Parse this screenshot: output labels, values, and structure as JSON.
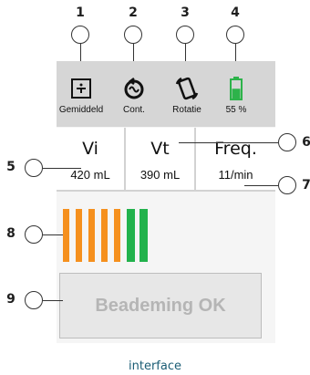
{
  "callouts": {
    "c1": "1",
    "c2": "2",
    "c3": "3",
    "c4": "4",
    "c5": "5",
    "c6": "6",
    "c7": "7",
    "c8": "8",
    "c9": "9"
  },
  "topbar": {
    "mode": {
      "icon": "average-icon",
      "label": "Gemiddeld"
    },
    "cont": {
      "icon": "continuous-cycle-icon",
      "label": "Cont."
    },
    "rotation": {
      "icon": "rotate-phone-icon",
      "label": "Rotatie"
    },
    "battery": {
      "icon": "battery-icon",
      "label": "55 %",
      "level": 0.55
    }
  },
  "values": {
    "vi": {
      "label": "Vi",
      "value": "420 mL"
    },
    "vt": {
      "label": "Vt",
      "value": "390 mL"
    },
    "freq": {
      "label": "Freq.",
      "value": "11/min"
    }
  },
  "bars": {
    "colors": [
      "#f5901e",
      "#f5901e",
      "#f5901e",
      "#f5901e",
      "#f5901e",
      "#22b24c",
      "#22b24c"
    ]
  },
  "status": {
    "label": "Beademing OK"
  },
  "caption": "interface",
  "colors": {
    "battery": "#2db34a",
    "orange": "#f5901e",
    "green": "#22b24c",
    "caption": "#1a5c74"
  }
}
